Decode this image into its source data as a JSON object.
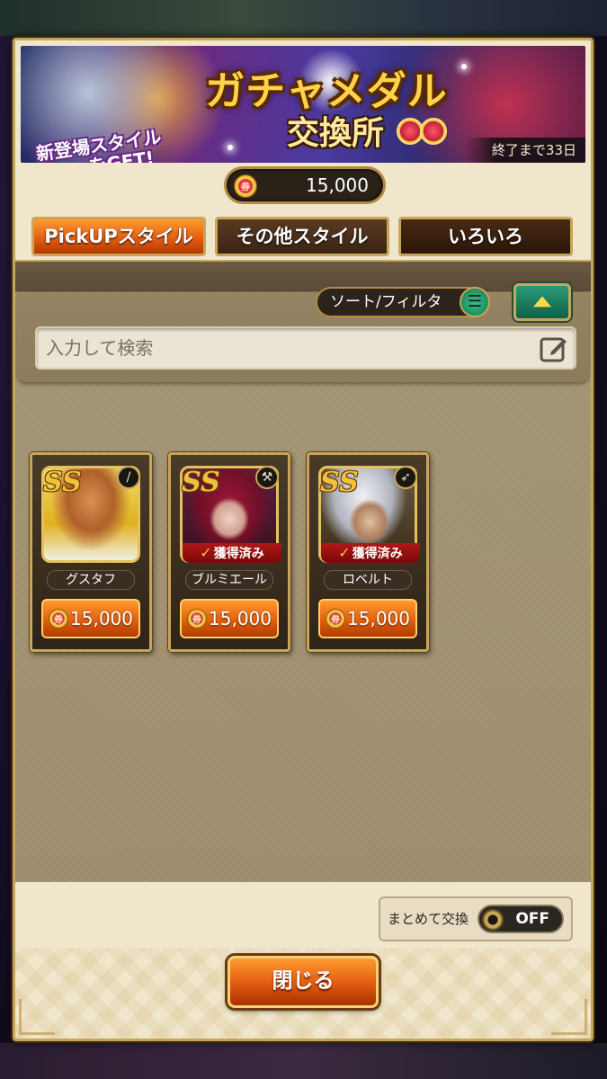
{
  "banner": {
    "title": "ガチャメダル",
    "subtitle": "交換所",
    "promo_line1": "新登場スタイル",
    "promo_line2": "をGET!",
    "days_remaining": "終了まで33日"
  },
  "currency": {
    "icon": "gacha-medal-icon",
    "amount": "15,000"
  },
  "tabs": [
    {
      "label": "PickUPスタイル",
      "active": true
    },
    {
      "label": "その他スタイル",
      "active": false
    },
    {
      "label": "いろいろ",
      "active": false
    }
  ],
  "filter": {
    "sort_label": "ソート/フィルタ",
    "search_placeholder": "入力して検索",
    "search_value": ""
  },
  "cards": [
    {
      "name": "グスタフ",
      "rank": "SS",
      "price": "15,000",
      "owned": false,
      "owned_label": "",
      "weapon_icon": "sword-icon"
    },
    {
      "name": "ブルミエール",
      "rank": "SS",
      "price": "15,000",
      "owned": true,
      "owned_label": "獲得済み",
      "weapon_icon": "axe-icon"
    },
    {
      "name": "ロベルト",
      "rank": "SS",
      "price": "15,000",
      "owned": true,
      "owned_label": "獲得済み",
      "weapon_icon": "bow-icon"
    }
  ],
  "bulk_exchange": {
    "label": "まとめて交換",
    "state": "OFF"
  },
  "close_button": "閉じる",
  "colors": {
    "accent_orange": "#e05a10",
    "gold_border": "#c9a55a",
    "owned_red": "#b01818",
    "toggle_teal": "#2a9a7a"
  }
}
